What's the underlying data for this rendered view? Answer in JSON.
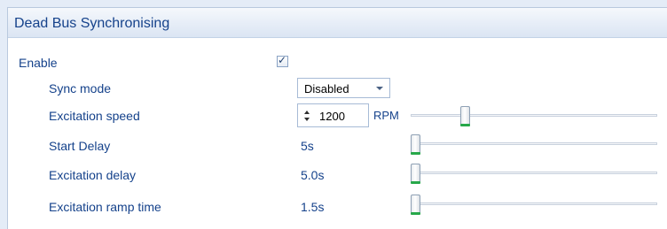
{
  "panel": {
    "title": "Dead Bus Synchronising"
  },
  "enable": {
    "label": "Enable",
    "checked": true
  },
  "rows": {
    "sync_mode": {
      "label": "Sync mode",
      "value": "Disabled"
    },
    "excitation_speed": {
      "label": "Excitation speed",
      "value": "1200",
      "unit": "RPM",
      "slider_level": 0.21
    },
    "start_delay": {
      "label": "Start Delay",
      "value": "5s",
      "slider_level": 0.0
    },
    "excitation_delay": {
      "label": "Excitation delay",
      "value": "5.0s",
      "slider_level": 0.0
    },
    "excitation_ramp_time": {
      "label": "Excitation ramp time",
      "value": "1.5s",
      "slider_level": 0.0
    }
  },
  "icons": {
    "checkbox": "check-icon",
    "dropdown": "chevron-down-icon",
    "spin_up": "arrow-up-icon",
    "spin_down": "arrow-down-icon"
  },
  "colors": {
    "label": "#15428b",
    "header_bg": "#e6edf7",
    "thumb_accent": "#27a84a"
  }
}
